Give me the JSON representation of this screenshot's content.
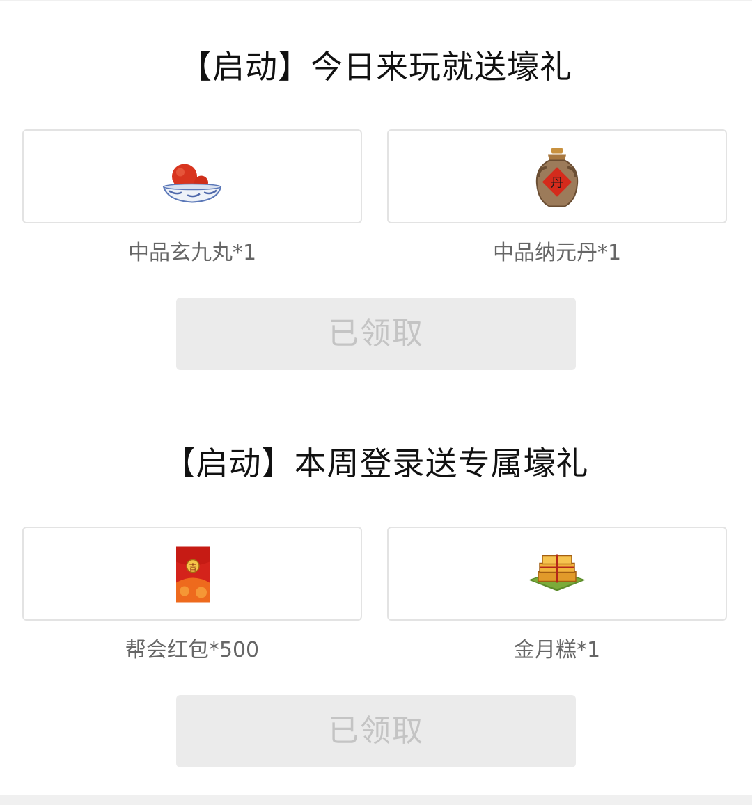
{
  "sections": [
    {
      "title": "【启动】今日来玩就送壕礼",
      "items": [
        {
          "icon": "pill-bowl-icon",
          "label": "中品玄九丸*1"
        },
        {
          "icon": "elixir-jar-icon",
          "label": "中品纳元丹*1"
        }
      ],
      "button_label": "已领取"
    },
    {
      "title": "【启动】本周登录送专属壕礼",
      "items": [
        {
          "icon": "red-envelope-icon",
          "label": "帮会红包*500"
        },
        {
          "icon": "golden-mooncake-icon",
          "label": "金月糕*1"
        }
      ],
      "button_label": "已领取"
    }
  ],
  "colors": {
    "title": "#111111",
    "label": "#666666",
    "button_bg": "#ebebeb",
    "button_text": "#c4c4c4",
    "card_border": "#e3e3e3"
  }
}
